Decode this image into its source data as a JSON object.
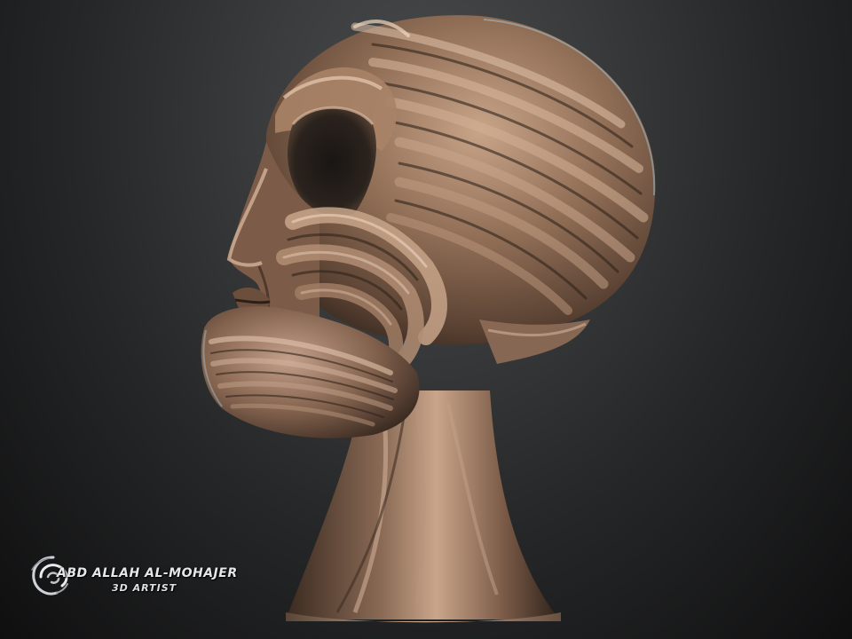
{
  "scene": {
    "subject": "sculpted-head-bust",
    "colors": {
      "background_top": "#4a4b4c",
      "background_bottom": "#0f0f10",
      "skin_base": "#8a6a52",
      "skin_highlight": "#d9b59a",
      "skin_shadow": "#3a2a20",
      "rim_light": "#a7c3d0"
    }
  },
  "watermark": {
    "logo_icon": "swirl-logo-icon",
    "name": "ABD ALLAH AL-MOHAJER",
    "title": "3D ARTIST"
  }
}
